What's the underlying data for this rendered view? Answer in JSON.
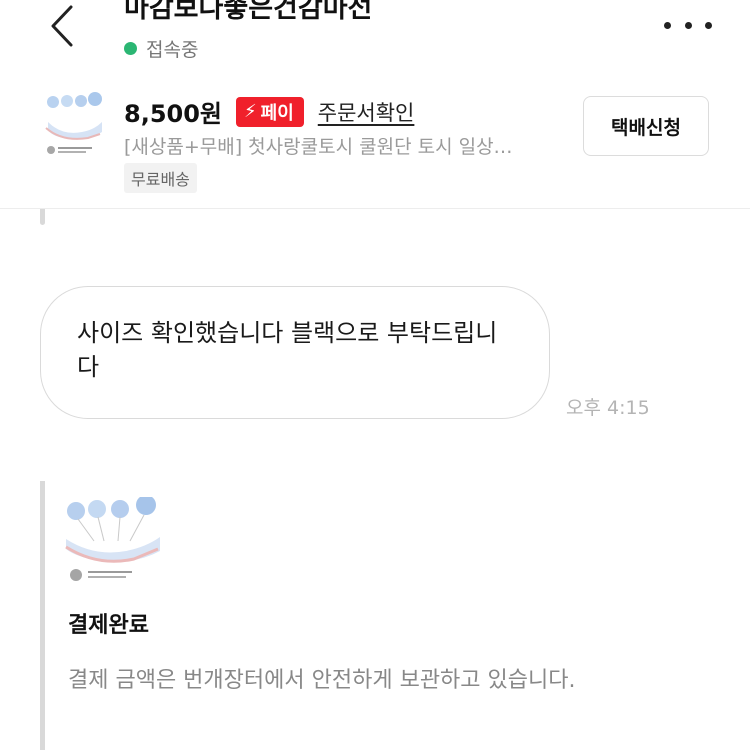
{
  "header": {
    "title": "마감보다좋은건감마선",
    "status": "접속중",
    "status_color": "#2bb673",
    "back_icon": "chevron-left-icon",
    "more_icon": "more-horizontal-icon"
  },
  "product": {
    "price": "8,500원",
    "pay_badge": "페이",
    "pay_badge_icon": "lightning-icon",
    "pay_badge_color": "#f0202b",
    "order_link": "주문서확인",
    "description": "[새상품+무배] 첫사랑쿨토시 쿨원단 토시 일상…",
    "shipping_tag": "무료배송",
    "delivery_button": "택배신청"
  },
  "chat": {
    "message": {
      "text": "사이즈 확인했습니다 블랙으로 부탁드립니다",
      "time": "오후 4:15"
    },
    "payment_card": {
      "title": "결제완료",
      "description": "결제 금액은 번개장터에서 안전하게 보관하고 있습니다."
    }
  }
}
